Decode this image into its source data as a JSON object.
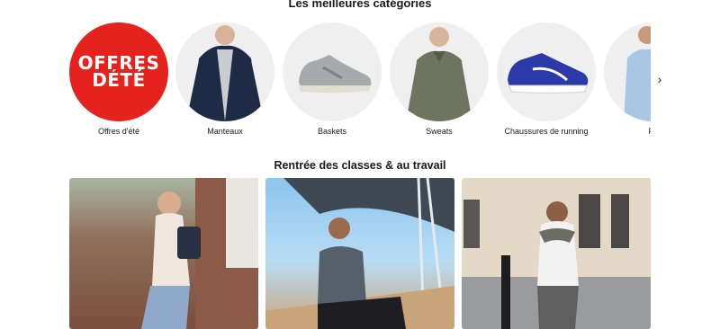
{
  "sections": {
    "categories_title": "Les meilleures catégories",
    "back_to_school_title": "Rentrée des classes & au travail"
  },
  "categories": [
    {
      "label": "Offres d'été",
      "promo_line1": "OFFRES",
      "promo_line2": "DÉTÉ"
    },
    {
      "label": "Manteaux"
    },
    {
      "label": "Baskets"
    },
    {
      "label": "Sweats"
    },
    {
      "label": "Chaussures de running"
    },
    {
      "label": "Po"
    }
  ],
  "icons": {
    "next": "chevron-right-icon"
  },
  "colors": {
    "promo_red": "#e5221d",
    "circle_bg": "#efefef",
    "running_shoe": "#2b3aa8"
  }
}
